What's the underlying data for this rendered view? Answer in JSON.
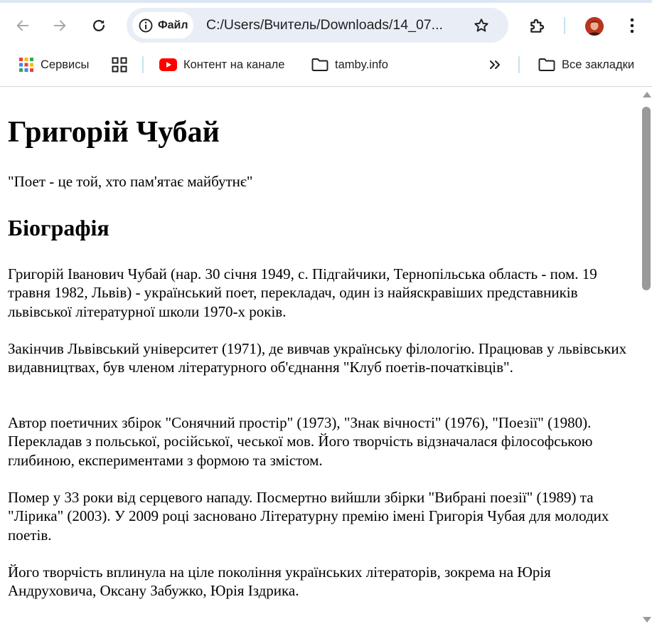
{
  "browser": {
    "omnibox": {
      "chip_label": "Файл",
      "url": "C:/Users/Вчитель/Downloads/14_07..."
    },
    "bookmarks": [
      {
        "label": "Сервисы",
        "icon": "apps-grid-icon"
      },
      {
        "label": "",
        "icon": "tab-groups-icon"
      },
      {
        "label": "Контент на канале",
        "icon": "youtube-icon"
      },
      {
        "label": "tamby.info",
        "icon": "folder-icon"
      },
      {
        "label": "Все закладки",
        "icon": "folder-icon"
      }
    ],
    "colors": {
      "omnibox_bg": "#e9eef6",
      "youtube_red": "#ff0000",
      "scrollbar": "#9a9a9a"
    }
  },
  "page": {
    "title": "Григорій Чубай",
    "quote": "\"Поет - це той, хто пам'ятає майбутнє\"",
    "section_title": "Біографія",
    "paragraphs": [
      "Григорій Іванович Чубай (нар. 30 січня 1949, с. Підгайчики, Тернопільська область - пом. 19 травня 1982, Львів) - український поет, перекладач, один із найяскравіших представників львівської літературної школи 1970-х років.",
      "Закінчив Львівський університет (1971), де вивчав українську філологію. Працював у львівських видавництвах, був членом літературного об'єднання \"Клуб поетів-початківців\".",
      "Автор поетичних збірок \"Сонячний простір\" (1973), \"Знак вічності\" (1976), \"Поезії\" (1980). Перекладав з польської, російської, чеської мов. Його творчість відзначалася філософською глибиною, експериментами з формою та змістом.",
      "Помер у 33 роки від серцевого нападу. Посмертно вийшли збірки \"Вибрані поезії\" (1989) та \"Лірика\" (2003). У 2009 році засновано Літературну премію імені Григорія Чубая для молодих поетів.",
      "Його творчість вплинула на ціле покоління українських літераторів, зокрема на Юрія Андруховича, Оксану Забужко, Юрія Іздрика."
    ]
  }
}
